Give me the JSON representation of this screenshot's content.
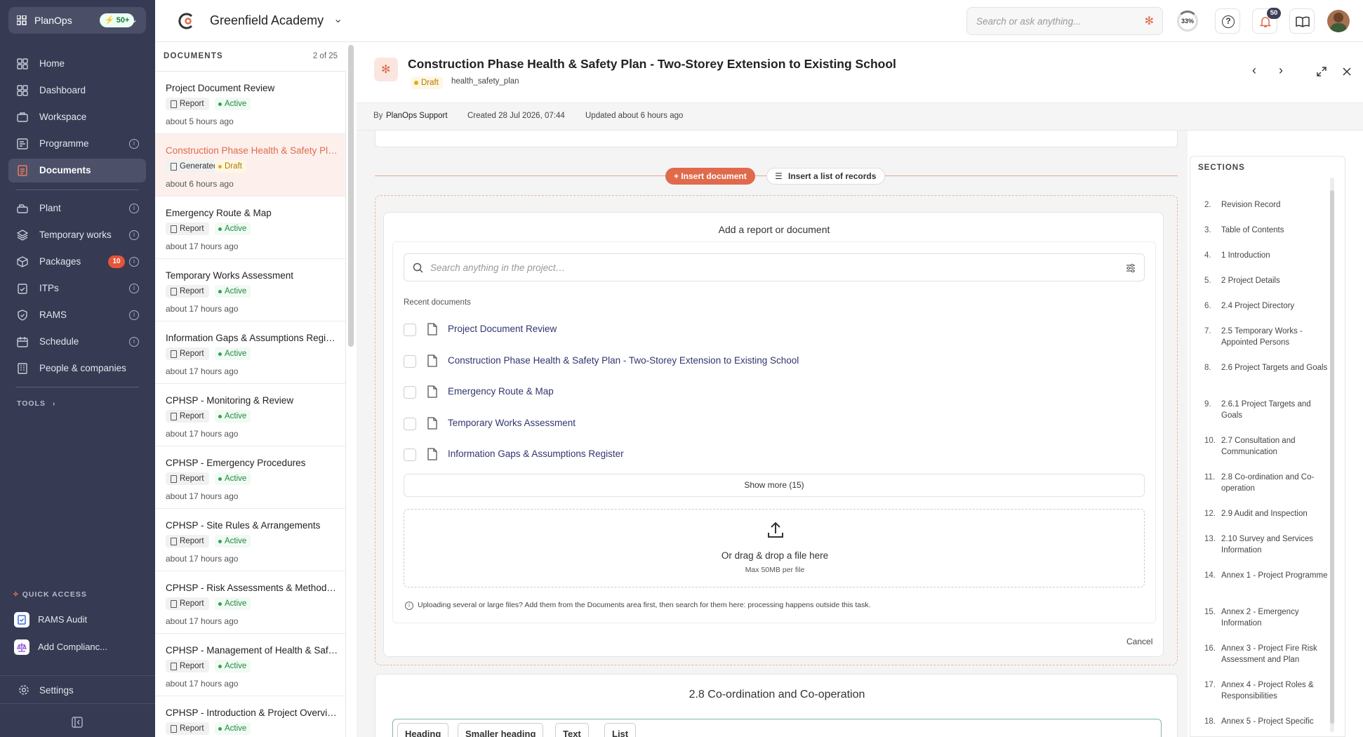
{
  "nav": {
    "brand": "PlanOps",
    "brand_badge": "50+",
    "items": [
      {
        "label": "Home"
      },
      {
        "label": "Dashboard"
      },
      {
        "label": "Workspace"
      },
      {
        "label": "Programme"
      },
      {
        "label": "Documents"
      },
      {
        "label": "Plant"
      },
      {
        "label": "Temporary works"
      },
      {
        "label": "Packages",
        "count": "10"
      },
      {
        "label": "ITPs"
      },
      {
        "label": "RAMS"
      },
      {
        "label": "Schedule"
      },
      {
        "label": "People & companies"
      }
    ],
    "tools_label": "TOOLS",
    "quick_access_label": "QUICK ACCESS",
    "quick_access": [
      {
        "label": "RAMS Audit"
      },
      {
        "label": "Add Complianc..."
      }
    ],
    "settings_label": "Settings"
  },
  "topbar": {
    "project": "Greenfield Academy",
    "search_placeholder": "Search or ask anything...",
    "progress": "33%",
    "notifications": "50"
  },
  "list": {
    "title": "DOCUMENTS",
    "count": "2 of 25",
    "rows": [
      {
        "title": "Project Document Review",
        "tag": "Report",
        "status": "Active",
        "time": "about 5 hours ago"
      },
      {
        "title": "Construction Phase Health & Safety Plan - Two-Storey Extension to Existing School",
        "tag": "Generated",
        "status": "Draft",
        "time": "about 6 hours ago"
      },
      {
        "title": "Emergency Route & Map",
        "tag": "Report",
        "status": "Active",
        "time": "about 17 hours ago"
      },
      {
        "title": "Temporary Works Assessment",
        "tag": "Report",
        "status": "Active",
        "time": "about 17 hours ago"
      },
      {
        "title": "Information Gaps & Assumptions Register",
        "tag": "Report",
        "status": "Active",
        "time": "about 17 hours ago"
      },
      {
        "title": "CPHSP - Monitoring & Review",
        "tag": "Report",
        "status": "Active",
        "time": "about 17 hours ago"
      },
      {
        "title": "CPHSP - Emergency Procedures",
        "tag": "Report",
        "status": "Active",
        "time": "about 17 hours ago"
      },
      {
        "title": "CPHSP - Site Rules & Arrangements",
        "tag": "Report",
        "status": "Active",
        "time": "about 17 hours ago"
      },
      {
        "title": "CPHSP - Risk Assessments & Method Statements",
        "tag": "Report",
        "status": "Active",
        "time": "about 17 hours ago"
      },
      {
        "title": "CPHSP - Management of Health & Safety",
        "tag": "Report",
        "status": "Active",
        "time": "about 17 hours ago"
      },
      {
        "title": "CPHSP - Introduction & Project Overview",
        "tag": "Report",
        "status": "Active",
        "time": ""
      }
    ]
  },
  "doc": {
    "title": "Construction Phase Health & Safety Plan - Two-Storey Extension to Existing School",
    "status": "Draft",
    "type": "health_safety_plan",
    "by": "By",
    "author": "PlanOps Support",
    "created": "Created 28 Jul 2026, 07:44",
    "updated": "Updated about 6 hours ago"
  },
  "editor": {
    "insert_document": "Insert document",
    "insert_list": "Insert a list of records",
    "panel_title": "Add a report or document",
    "search_placeholder": "Search anything in the project…",
    "recent_label": "Recent documents",
    "recent": [
      "Project Document Review",
      "Construction Phase Health & Safety Plan - Two-Storey Extension to Existing School",
      "Emergency Route & Map",
      "Temporary Works Assessment",
      "Information Gaps & Assumptions Register"
    ],
    "show_more": "Show more (15)",
    "drop_text": "Or drag & drop a file here",
    "drop_sub": "Max 50MB per file",
    "hint": "Uploading several or large files? Add them from the Documents area first, then search for them here: processing happens outside this task.",
    "cancel": "Cancel",
    "next_heading": "2.8 Co-ordination and Co-operation",
    "toolbar": [
      "Heading",
      "Smaller heading",
      "Text",
      "List"
    ]
  },
  "sections": {
    "title": "SECTIONS",
    "items": [
      {
        "n": "2.",
        "t": "Revision Record"
      },
      {
        "n": "3.",
        "t": "Table of Contents"
      },
      {
        "n": "4.",
        "t": "1 Introduction"
      },
      {
        "n": "5.",
        "t": "2 Project Details"
      },
      {
        "n": "6.",
        "t": "2.4 Project Directory"
      },
      {
        "n": "7.",
        "t": "2.5 Temporary Works - Appointed Persons"
      },
      {
        "n": "8.",
        "t": "2.6 Project Targets and Goals"
      },
      {
        "n": "9.",
        "t": "2.6.1 Project Targets and Goals"
      },
      {
        "n": "10.",
        "t": "2.7 Consultation and Communication"
      },
      {
        "n": "11.",
        "t": "2.8 Co-ordination and Co-operation"
      },
      {
        "n": "12.",
        "t": "2.9 Audit and Inspection"
      },
      {
        "n": "13.",
        "t": "2.10 Survey and Services Information"
      },
      {
        "n": "14.",
        "t": "Annex 1 - Project Programme"
      },
      {
        "n": "15.",
        "t": "Annex 2 - Emergency Information"
      },
      {
        "n": "16.",
        "t": "Annex 3 - Project Fire Risk Assessment and Plan"
      },
      {
        "n": "17.",
        "t": "Annex 4 - Project Roles & Responsibilities"
      },
      {
        "n": "18.",
        "t": "Annex 5 - Project Specific"
      }
    ]
  }
}
